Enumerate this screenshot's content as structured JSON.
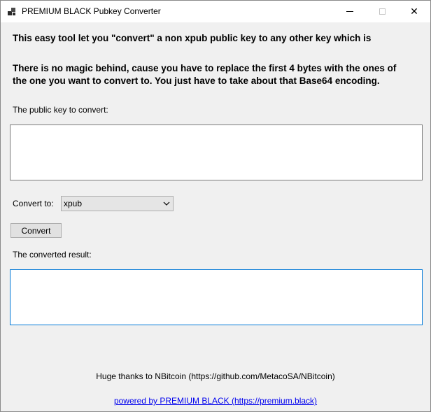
{
  "window": {
    "title": "PREMIUM BLACK Pubkey Converter"
  },
  "intro": {
    "line1": "This easy tool let you \"convert\" a non xpub public key to any other key which is",
    "line2": "There is no magic behind, cause you have to replace the first 4 bytes with the ones of",
    "line3": "the one you want to convert to. You just have to take about that Base64 encoding."
  },
  "input": {
    "label": "The public key to convert:",
    "value": ""
  },
  "convert_to": {
    "label": "Convert to:",
    "selected": "xpub"
  },
  "convert_button": {
    "label": "Convert"
  },
  "output": {
    "label": "The converted result:",
    "value": ""
  },
  "footer": {
    "thanks": "Huge thanks to NBitcoin (https://github.com/MetacoSA/NBitcoin)",
    "powered_by": "powered by PREMIUM BLACK (https://premium.black)"
  },
  "colors": {
    "window_bg": "#f0f0f0",
    "focus_border": "#0078d7",
    "link": "#0000ee"
  }
}
